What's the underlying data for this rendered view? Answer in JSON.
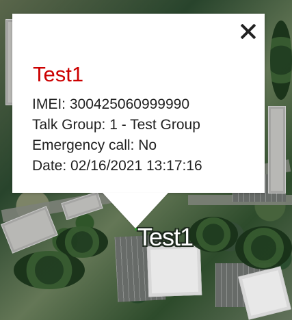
{
  "popup": {
    "title": "Test1",
    "imei": "IMEI: 300425060999990",
    "talk_group": "Talk Group: 1 - Test Group",
    "emergency_call": "Emergency call: No",
    "date": "Date: 02/16/2021 13:17:16",
    "close_icon": "close-icon"
  },
  "map": {
    "marker_label": "Test1"
  },
  "colors": {
    "title": "#cc0000",
    "popup_background": "#ffffff",
    "text": "#1f1f1f"
  }
}
